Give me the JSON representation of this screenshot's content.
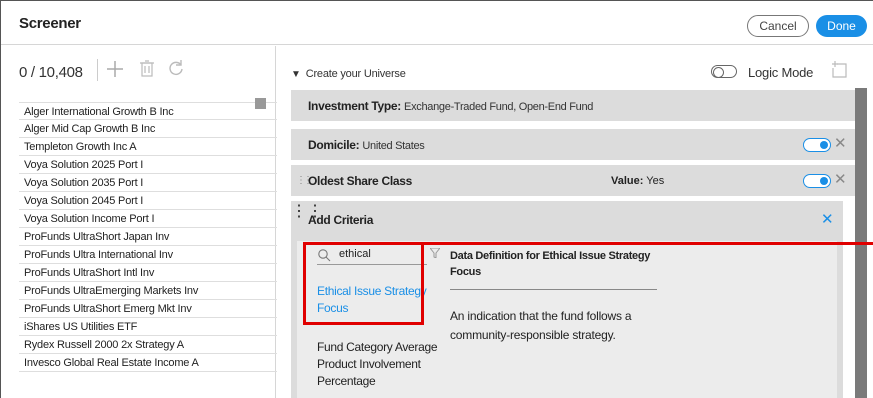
{
  "header": {
    "title": "Screener",
    "cancel_label": "Cancel",
    "done_label": "Done"
  },
  "left": {
    "count": "0 / 10,408",
    "items": [
      "Alger International Growth B Inc",
      "Alger Mid Cap Growth B Inc",
      "Templeton Growth Inc A",
      "Voya Solution 2025 Port I",
      "Voya Solution 2035 Port I",
      "Voya Solution 2045 Port I",
      "Voya Solution Income Port I",
      "ProFunds UltraShort Japan Inv",
      "ProFunds Ultra International Inv",
      "ProFunds UltraShort Intl Inv",
      "ProFunds UltraEmerging Markets Inv",
      "ProFunds UltraShort Emerg Mkt Inv",
      "iShares US Utilities ETF",
      "Rydex Russell 2000 2x Strategy A",
      "Invesco Global Real Estate Income A"
    ]
  },
  "right": {
    "universe_label": "Create your Universe",
    "logic_mode_label": "Logic Mode",
    "rows": {
      "investment_type": {
        "label": "Investment Type:",
        "value": "Exchange-Traded Fund, Open-End Fund"
      },
      "domicile": {
        "label": "Domicile:",
        "value": "United States"
      },
      "oldest_share_class": {
        "label": "Oldest Share Class",
        "value_label": "Value:",
        "value": "Yes"
      },
      "add_criteria": {
        "label": "Add Criteria"
      }
    },
    "search": {
      "value": "ethical"
    },
    "results": [
      "Ethical Issue Strategy Focus",
      "Fund Category Average Product Involvement Percentage"
    ],
    "definition": {
      "title": "Data Definition for Ethical Issue Strategy Focus",
      "text": "An indication that the fund follows a community-responsible strategy."
    }
  },
  "colors": {
    "accent": "#1a8fe6",
    "highlight": "#e00000",
    "panel": "#dcdcdc"
  }
}
